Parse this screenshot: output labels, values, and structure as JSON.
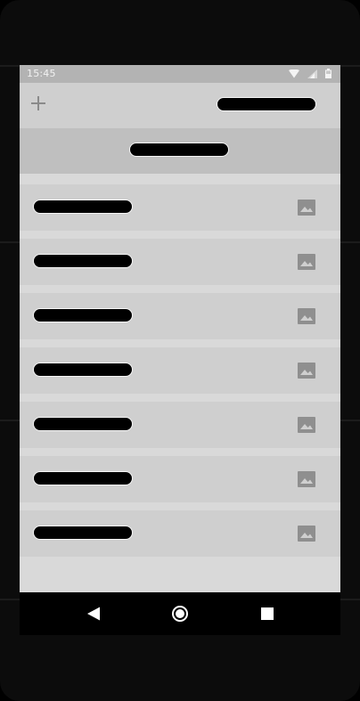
{
  "status_bar": {
    "time": "15:45",
    "icons": [
      "wifi-icon",
      "cell-signal-icon",
      "battery-icon"
    ]
  },
  "app_bar": {
    "add_icon": "plus-icon",
    "title": ""
  },
  "header": {
    "label": ""
  },
  "list": {
    "items": [
      {
        "label": "",
        "icon": "image-icon"
      },
      {
        "label": "",
        "icon": "image-icon"
      },
      {
        "label": "",
        "icon": "image-icon"
      },
      {
        "label": "",
        "icon": "image-icon"
      },
      {
        "label": "",
        "icon": "image-icon"
      },
      {
        "label": "",
        "icon": "image-icon"
      },
      {
        "label": "",
        "icon": "image-icon"
      }
    ]
  },
  "nav_bar": {
    "buttons": [
      "back-icon",
      "home-icon",
      "recents-icon"
    ]
  },
  "colors": {
    "status_bar": "#b3b3b3",
    "app_bar": "#cfcfcf",
    "header_band": "#bfbfbf",
    "screen_bg": "#d9d9d9",
    "list_item": "#cfcfcf",
    "text_placeholder": "#000000",
    "icon": "#8f8f8f"
  }
}
